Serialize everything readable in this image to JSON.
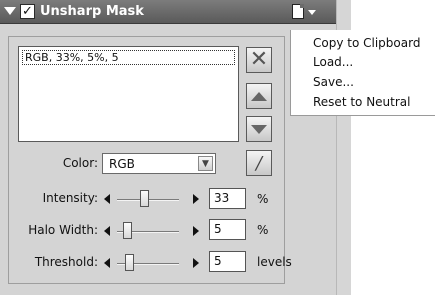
{
  "panel": {
    "title": "Unsharp Mask",
    "enabled": true
  },
  "presets": {
    "items": [
      "RGB, 33%, 5%, 5"
    ]
  },
  "color": {
    "label": "Color:",
    "value": "RGB"
  },
  "intensity": {
    "label": "Intensity:",
    "value": "33",
    "unit": "%"
  },
  "halo_width": {
    "label": "Halo Width:",
    "value": "5",
    "unit": "%"
  },
  "threshold": {
    "label": "Threshold:",
    "value": "5",
    "unit": "levels"
  },
  "menu": {
    "items": [
      "Copy to Clipboard",
      "Load...",
      "Save...",
      "Reset to Neutral"
    ]
  },
  "icons": {
    "collapse": "collapse-triangle-icon",
    "enable": "checkmark-icon",
    "document": "document-icon",
    "menu_dropdown": "chevron-down-icon",
    "delete": "close-icon",
    "move_up": "arrow-up-icon",
    "move_down": "arrow-down-icon",
    "eyedropper": "eyedropper-icon"
  },
  "colors": {
    "titlebar": "#6a6a6a",
    "panel_bg": "#d4d4d4",
    "menu_bg": "#ffffff"
  }
}
